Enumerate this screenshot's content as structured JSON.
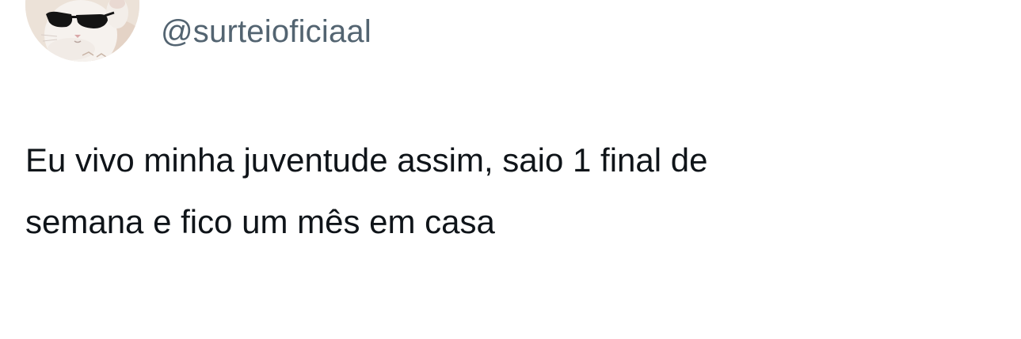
{
  "tweet": {
    "handle": "@surteioficiaal",
    "avatar_icon": "cat-sunglasses-avatar",
    "text_line_1": "Eu vivo minha juventude assim, saio 1 final de",
    "text_line_2": "semana e fico um mês em casa"
  },
  "colors": {
    "handle": "#536471",
    "text": "#0f1419",
    "background": "#ffffff"
  }
}
